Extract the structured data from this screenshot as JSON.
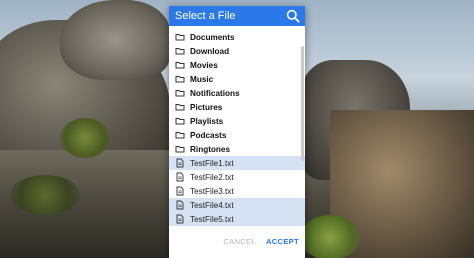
{
  "dialog": {
    "title": "Select a File",
    "search_icon": "search-icon",
    "folders": [
      {
        "label": "Documents",
        "icon": "folder-icon"
      },
      {
        "label": "Download",
        "icon": "folder-icon"
      },
      {
        "label": "Movies",
        "icon": "folder-icon"
      },
      {
        "label": "Music",
        "icon": "folder-icon"
      },
      {
        "label": "Notifications",
        "icon": "folder-icon"
      },
      {
        "label": "Pictures",
        "icon": "folder-icon"
      },
      {
        "label": "Playlists",
        "icon": "folder-icon"
      },
      {
        "label": "Podcasts",
        "icon": "folder-icon"
      },
      {
        "label": "Ringtones",
        "icon": "folder-icon"
      }
    ],
    "files": [
      {
        "label": "TestFile1.txt",
        "icon": "file-icon",
        "selected": true
      },
      {
        "label": "TestFile2.txt",
        "icon": "file-icon",
        "selected": false
      },
      {
        "label": "TestFile3.txt",
        "icon": "file-icon",
        "selected": false
      },
      {
        "label": "TestFile4.txt",
        "icon": "file-icon",
        "selected": true
      },
      {
        "label": "TestFile5.txt",
        "icon": "file-icon",
        "selected": true
      }
    ],
    "cancel_label": "CANCEL",
    "accept_label": "ACCEPT"
  },
  "colors": {
    "accent": "#2b79e8",
    "selected_row": "#d5e2f4",
    "disabled_text": "#b5b5b5"
  }
}
